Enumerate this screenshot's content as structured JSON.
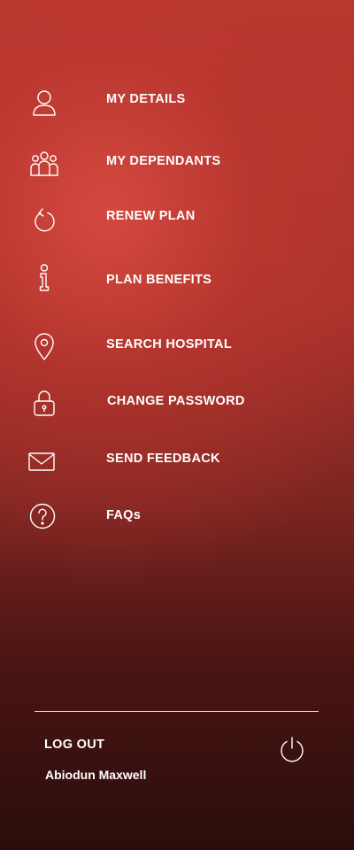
{
  "menu": {
    "items": [
      {
        "label": "MY DETAILS",
        "icon": "user-icon"
      },
      {
        "label": "MY DEPENDANTS",
        "icon": "group-icon"
      },
      {
        "label": "RENEW PLAN",
        "icon": "renew-icon"
      },
      {
        "label": "PLAN BENEFITS",
        "icon": "info-icon"
      },
      {
        "label": "SEARCH HOSPITAL",
        "icon": "location-pin-icon"
      },
      {
        "label": "CHANGE PASSWORD",
        "icon": "lock-icon"
      },
      {
        "label": "SEND FEEDBACK",
        "icon": "envelope-icon"
      },
      {
        "label": "FAQs",
        "icon": "question-icon"
      }
    ]
  },
  "footer": {
    "logout_label": "LOG OUT",
    "username": "Abiodun Maxwell",
    "power_icon": "power-icon"
  }
}
